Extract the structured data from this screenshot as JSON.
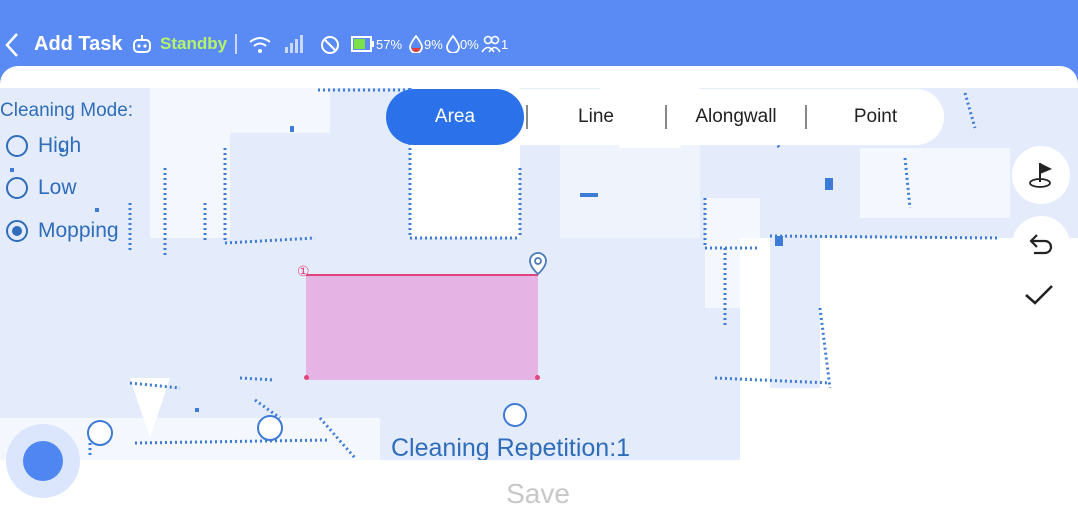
{
  "header": {
    "title": "Add Task",
    "status": "Standby",
    "battery": "57%",
    "water_a": "9%",
    "water_b": "0%",
    "people": "1"
  },
  "mode": {
    "label": "Cleaning Mode:",
    "options": [
      {
        "label": "High",
        "selected": false
      },
      {
        "label": "Low",
        "selected": false
      },
      {
        "label": "Mopping",
        "selected": true
      }
    ]
  },
  "tabs": {
    "items": [
      "Area",
      "Line",
      "Alongwall",
      "Point"
    ],
    "active": "Area"
  },
  "area": {
    "start_marker": "①"
  },
  "repetition": {
    "label": "Cleaning Repetition:",
    "value": "1"
  },
  "save": {
    "label": "Save"
  },
  "colors": {
    "header": "#5a8bf5",
    "accent": "#2b72ea",
    "status": "#b6f36a",
    "area_fill": "#e6b4e4",
    "area_border": "#e0457a",
    "map_bg": "#e4ecfb",
    "text_blue": "#2f6dba"
  },
  "icons": {
    "back": "chevron-left-icon",
    "robot": "robot-icon",
    "wifi": "wifi-icon",
    "signal": "signal-icon",
    "no_connection": "no-connection-icon",
    "battery": "battery-icon",
    "water": "water-drop-icon",
    "people": "people-icon",
    "flag": "flag-icon",
    "undo": "undo-icon",
    "confirm": "checkmark-icon",
    "location": "location-pin-icon"
  }
}
